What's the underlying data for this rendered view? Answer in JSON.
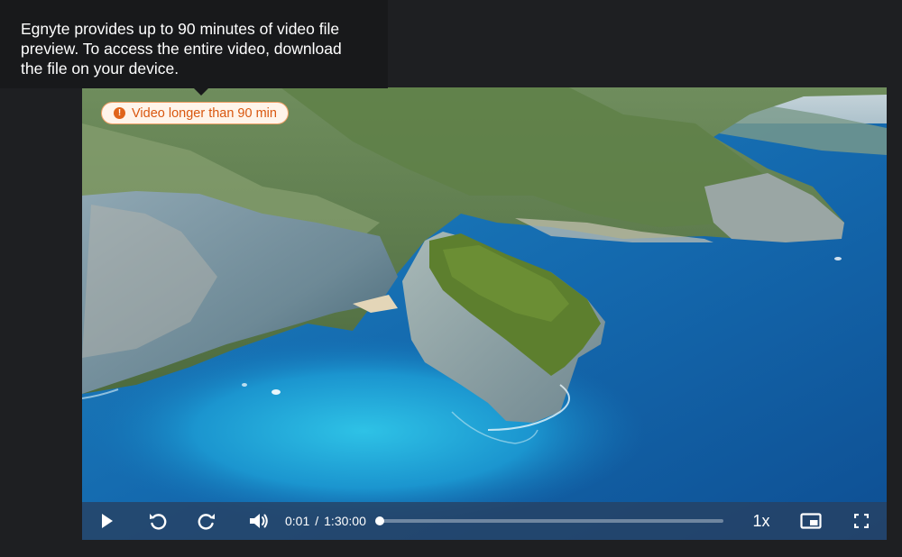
{
  "tooltip": {
    "line1": "Egnyte provides up to 90 minutes of video file",
    "line2": "preview. To access the entire video, download",
    "line3": "the file on your device."
  },
  "badge": {
    "text": "Video longer than 90 min",
    "icon": "exclamation-icon",
    "color": "#d9570f"
  },
  "player": {
    "current_time": "0:01",
    "separator": "/",
    "duration": "1:30:00",
    "progress_fraction": 0.0002,
    "speed": "1x",
    "icons": {
      "play": "play-icon",
      "rewind": "rewind-icon",
      "forward": "forward-icon",
      "volume": "volume-icon",
      "pip": "picture-in-picture-icon",
      "fullscreen": "fullscreen-icon"
    }
  },
  "colors": {
    "background": "#1e1f22",
    "tooltip_bg": "#18191b",
    "badge_bg": "#fff4ea",
    "badge_border": "#f0a065"
  }
}
